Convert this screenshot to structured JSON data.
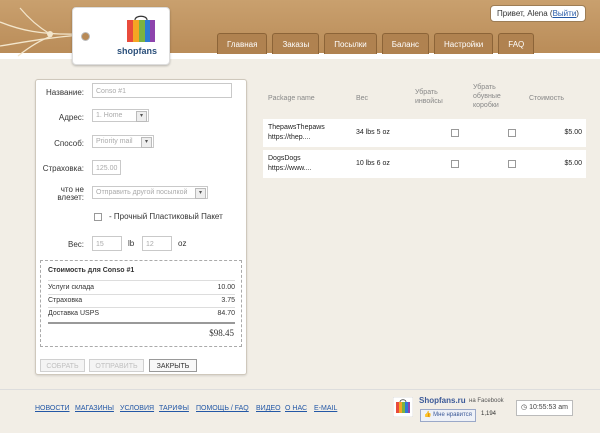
{
  "brand": {
    "logo_text": "shopfans"
  },
  "greeting": {
    "prefix": "Привет, Alena",
    "logout_label": "Выйти"
  },
  "nav": {
    "tabs": [
      "Главная",
      "Заказы",
      "Посылки",
      "Баланс",
      "Настройки",
      "FAQ"
    ]
  },
  "form": {
    "name_label": "Название:",
    "name_placeholder": "Conso #1",
    "address_label": "Адрес:",
    "address_value": "1. Home",
    "method_label": "Способ:",
    "method_value": "Priority mail",
    "insurance_label": "Страховка:",
    "insurance_value": "125.00",
    "nofit_label": "что не влезет:",
    "nofit_value": "Отправить другой посылкой",
    "plastic_label": "- Прочный Пластиковый Пакет",
    "weight_label": "Вес:",
    "weight_lb_value": "15",
    "weight_lb_unit": "lb",
    "weight_oz_value": "12",
    "weight_oz_unit": "oz"
  },
  "cost": {
    "title": "Стоимость для Conso #1",
    "rows": [
      {
        "label": "Услуги склада",
        "value": "10.00"
      },
      {
        "label": "Страховка",
        "value": "3.75"
      },
      {
        "label": "Доставка USPS",
        "value": "84.70"
      }
    ],
    "total": "$98.45"
  },
  "buttons": {
    "collect": "СОБРАТЬ",
    "send": "ОТПРАВИТЬ",
    "close": "ЗАКРЫТЬ"
  },
  "table": {
    "headers": [
      "Package name",
      "Вес",
      "Убрать инвойсы",
      "Убрать обувные коробки",
      "Стоимость"
    ],
    "rows": [
      {
        "name1": "ThepawsThepaws",
        "name2": "https://thep....",
        "weight": "34 lbs 5 oz",
        "cost": "$5.00"
      },
      {
        "name1": "DogsDogs",
        "name2": "https://www....",
        "weight": "10 lbs 6 oz",
        "cost": "$5.00"
      }
    ]
  },
  "footer": {
    "links": [
      "НОВОСТИ",
      "МАГАЗИНЫ",
      "УСЛОВИЯ",
      "ТАРИФЫ",
      "ПОМОЩЬ / FAQ",
      "ВИДЕО",
      "О НАС",
      "E-MAIL"
    ],
    "fb_title": "Shopfans.ru",
    "fb_on": "на Facebook",
    "fb_like": "Мне нравится",
    "fb_count": "1,194",
    "clock": "10:55:53 am"
  }
}
